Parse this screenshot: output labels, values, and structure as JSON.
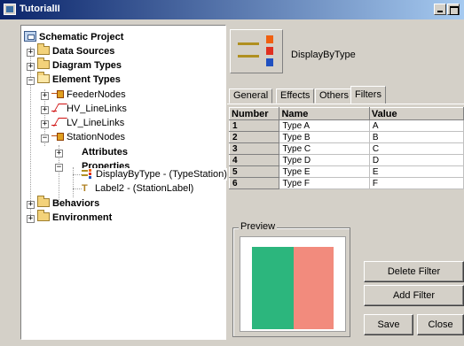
{
  "window": {
    "title": "TutorialII"
  },
  "tree": {
    "root": "Schematic Project",
    "items": [
      {
        "label": "Data Sources",
        "bold": true
      },
      {
        "label": "Diagram Types",
        "bold": true
      },
      {
        "label": "Element Types",
        "bold": true
      },
      {
        "label": "FeederNodes",
        "bold": false
      },
      {
        "label": "HV_LineLinks",
        "bold": false
      },
      {
        "label": "LV_LineLinks",
        "bold": false
      },
      {
        "label": "StationNodes",
        "bold": false
      },
      {
        "label": "Attributes",
        "bold": true
      },
      {
        "label": "Properties",
        "bold": true
      },
      {
        "label": "DisplayByType - (TypeStation)",
        "bold": false
      },
      {
        "label": "Label2 - (StationLabel)",
        "bold": false
      },
      {
        "label": "Behaviors",
        "bold": true
      },
      {
        "label": "Environment",
        "bold": true
      }
    ]
  },
  "properties": {
    "style_name": "DisplayByType",
    "style_colors": [
      "#f06010",
      "#e03020",
      "#2050c0"
    ],
    "tabs": [
      "General",
      "Effects",
      "Others",
      "Filters"
    ],
    "active_tab": "Filters",
    "table": {
      "columns": [
        "Number",
        "Name",
        "Value"
      ],
      "rows": [
        {
          "number": "1",
          "name": "Type A",
          "value": "A"
        },
        {
          "number": "2",
          "name": "Type B",
          "value": "B"
        },
        {
          "number": "3",
          "name": "Type C",
          "value": "C"
        },
        {
          "number": "4",
          "name": "Type D",
          "value": "D"
        },
        {
          "number": "5",
          "name": "Type E",
          "value": "E"
        },
        {
          "number": "6",
          "name": "Type F",
          "value": "F"
        }
      ]
    },
    "preview": {
      "label": "Preview",
      "colors": [
        "#2cb67d",
        "#f28b7d"
      ]
    },
    "buttons": {
      "delete_filter": "Delete Filter",
      "add_filter": "Add Filter",
      "save": "Save",
      "close": "Close"
    }
  }
}
